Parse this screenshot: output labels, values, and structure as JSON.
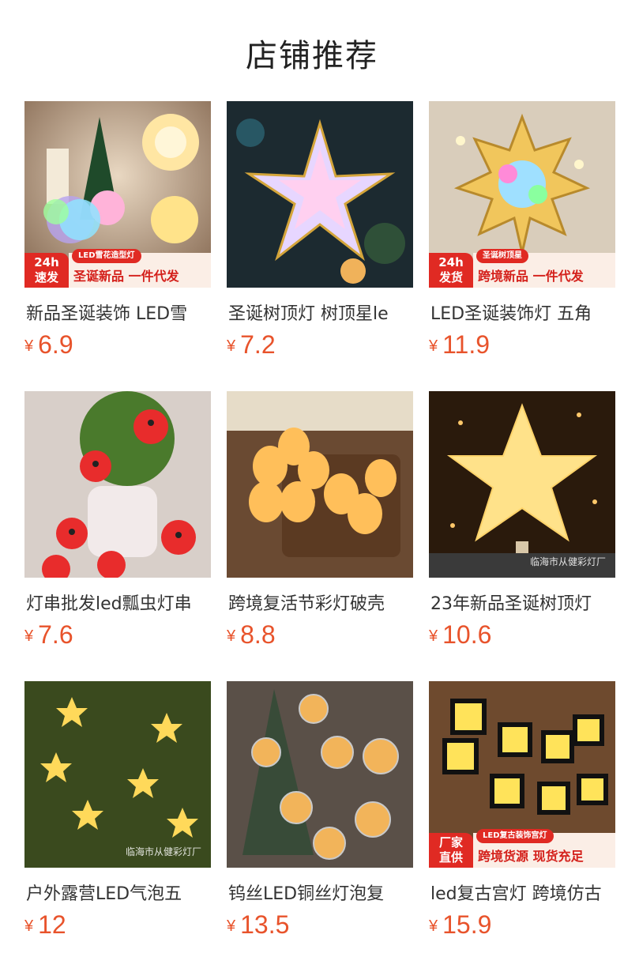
{
  "page": {
    "title": "店铺推荐"
  },
  "currency": "¥",
  "products": [
    {
      "name": "新品圣诞装饰 LED雪",
      "price": "6.9",
      "image": "snowflake-lights-image",
      "badge": {
        "left": "24h\n速发",
        "pill": "LED雪花造型灯",
        "slogan": "圣诞新品 一件代发"
      }
    },
    {
      "name": "圣诞树顶灯 树顶星le",
      "price": "7.2",
      "image": "tree-top-star-image"
    },
    {
      "name": "LED圣诞装饰灯 五角",
      "price": "11.9",
      "image": "colorful-star-topper-image",
      "badge": {
        "left": "24h\n发货",
        "pill": "圣诞树顶星",
        "slogan": "跨境新品 一件代发"
      }
    },
    {
      "name": "灯串批发led瓢虫灯串",
      "price": "7.6",
      "image": "ladybug-string-lights-image"
    },
    {
      "name": "跨境复活节彩灯破壳",
      "price": "8.8",
      "image": "easter-egg-lights-image"
    },
    {
      "name": "23年新品圣诞树顶灯",
      "price": "10.6",
      "image": "gold-star-topper-image",
      "watermark": "临海市从健彩灯厂"
    },
    {
      "name": "户外露营LED气泡五",
      "price": "12",
      "image": "star-fairy-lights-image",
      "watermark": "临海市从健彩灯厂"
    },
    {
      "name": "钨丝LED铜丝灯泡复",
      "price": "13.5",
      "image": "bulb-string-lights-image"
    },
    {
      "name": "led复古宫灯 跨境仿古",
      "price": "15.9",
      "image": "vintage-lantern-lights-image",
      "badge": {
        "left": "厂家\n直供",
        "pill": "LED复古装饰宫灯",
        "slogan": "跨境货源 现货充足"
      }
    }
  ]
}
